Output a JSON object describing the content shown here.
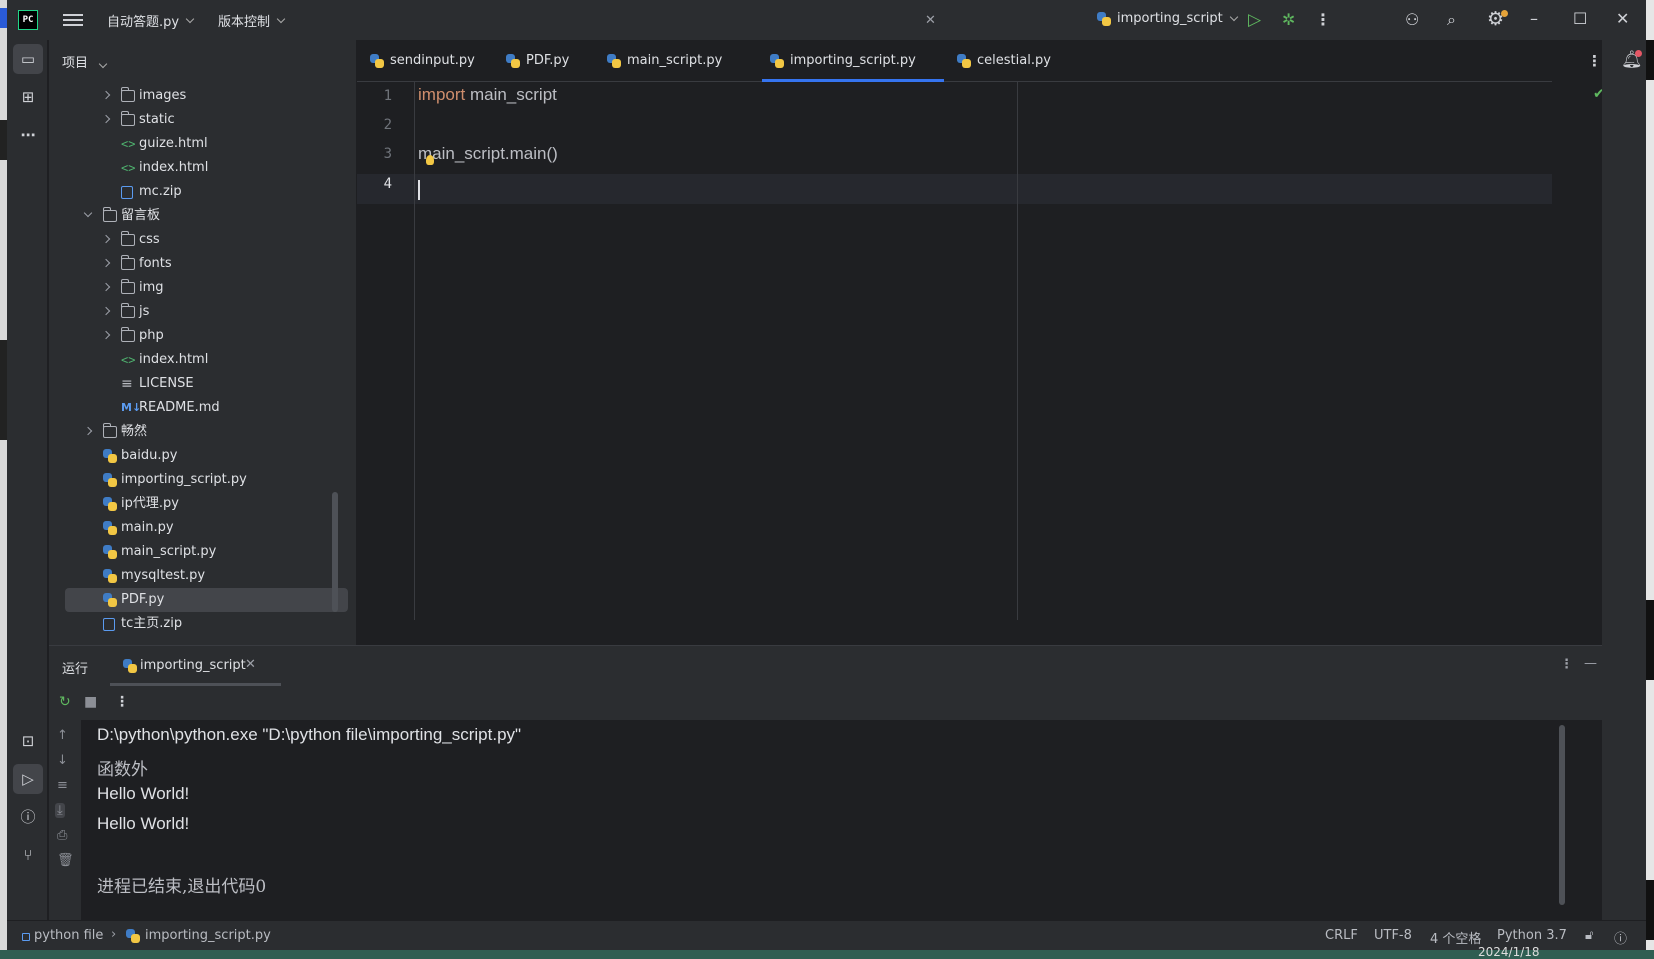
{
  "titlebar": {
    "logo": "PC",
    "project_name": "自动答题.py",
    "vcs_label": "版本控制",
    "run_config": "importing_script"
  },
  "project_panel": {
    "header": "项目",
    "tree": [
      {
        "label": "images",
        "type": "folder",
        "depth": 2,
        "state": "closed"
      },
      {
        "label": "static",
        "type": "folder",
        "depth": 2,
        "state": "closed"
      },
      {
        "label": "guize.html",
        "type": "html",
        "depth": 2
      },
      {
        "label": "index.html",
        "type": "html",
        "depth": 2
      },
      {
        "label": "mc.zip",
        "type": "zip",
        "depth": 2
      },
      {
        "label": "留言板",
        "type": "folder",
        "depth": 1,
        "state": "open"
      },
      {
        "label": "css",
        "type": "folder",
        "depth": 2,
        "state": "closed"
      },
      {
        "label": "fonts",
        "type": "folder",
        "depth": 2,
        "state": "closed"
      },
      {
        "label": "img",
        "type": "folder",
        "depth": 2,
        "state": "closed"
      },
      {
        "label": "js",
        "type": "folder",
        "depth": 2,
        "state": "closed"
      },
      {
        "label": "php",
        "type": "folder",
        "depth": 2,
        "state": "closed"
      },
      {
        "label": "index.html",
        "type": "html",
        "depth": 2
      },
      {
        "label": "LICENSE",
        "type": "text",
        "depth": 2
      },
      {
        "label": "README.md",
        "type": "md",
        "depth": 2
      },
      {
        "label": "畅然",
        "type": "folder",
        "depth": 1,
        "state": "closed"
      },
      {
        "label": "baidu.py",
        "type": "py",
        "depth": 1
      },
      {
        "label": "importing_script.py",
        "type": "py",
        "depth": 1
      },
      {
        "label": "ip代理.py",
        "type": "py",
        "depth": 1
      },
      {
        "label": "main.py",
        "type": "py",
        "depth": 1
      },
      {
        "label": "main_script.py",
        "type": "py",
        "depth": 1
      },
      {
        "label": "mysqltest.py",
        "type": "py",
        "depth": 1
      },
      {
        "label": "PDF.py",
        "type": "py",
        "depth": 1,
        "selected": true
      },
      {
        "label": "tc主页.zip",
        "type": "zip",
        "depth": 1
      }
    ]
  },
  "editor": {
    "tabs": [
      {
        "label": "sendinput.py",
        "active": false
      },
      {
        "label": "PDF.py",
        "active": false
      },
      {
        "label": "main_script.py",
        "active": false
      },
      {
        "label": "importing_script.py",
        "active": true
      },
      {
        "label": "celestial.py",
        "active": false
      }
    ],
    "line_numbers": [
      "1",
      "2",
      "3",
      "4"
    ],
    "code": {
      "line1_keyword": "import",
      "line1_rest": " main_script",
      "line3": "main_script.main()"
    }
  },
  "run_panel": {
    "title": "运行",
    "tab_label": "importing_script",
    "console": [
      "D:\\python\\python.exe \"D:\\python file\\importing_script.py\"",
      "函数外",
      "Hello World!",
      "Hello World!",
      "",
      "进程已结束,退出代码0"
    ]
  },
  "statusbar": {
    "path_root": "python file",
    "path_file": "importing_script.py",
    "line_ending": "CRLF",
    "encoding": "UTF-8",
    "indent": "4 个空格",
    "interpreter": "Python 3.7"
  },
  "taskbar": {
    "date": "2024/1/18"
  },
  "colors": {
    "accent": "#3574f0",
    "keyword": "#cf8e6d",
    "run_green": "#5fb85f",
    "panel_bg": "#2b2d30",
    "editor_bg": "#1e1f22"
  }
}
